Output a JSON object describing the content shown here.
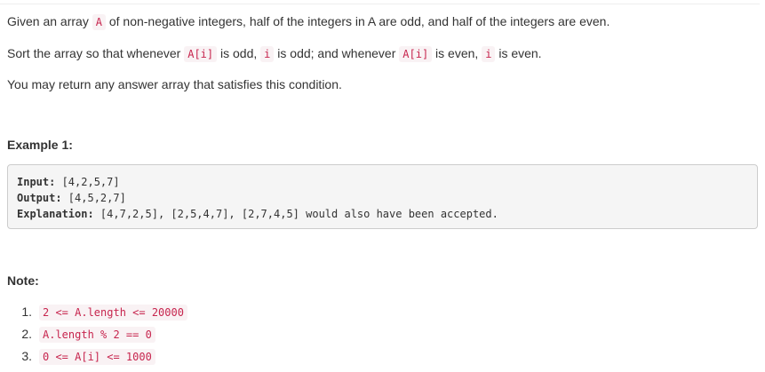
{
  "intro": {
    "p1": {
      "before": "Given an array ",
      "code": "A",
      "after": " of non-negative integers, half of the integers in A are odd, and half of the integers are even."
    },
    "p2": {
      "t1": "Sort the array so that whenever ",
      "c1": "A[i]",
      "t2": " is odd, ",
      "c2": "i",
      "t3": " is odd; and whenever ",
      "c3": "A[i]",
      "t4": " is even, ",
      "c4": "i",
      "t5": " is even."
    },
    "p3": "You may return any answer array that satisfies this condition."
  },
  "example": {
    "heading": "Example 1:",
    "lines": [
      {
        "key": "Input:",
        "value": " [4,2,5,7]"
      },
      {
        "key": "Output:",
        "value": " [4,5,2,7]"
      },
      {
        "key": "Explanation:",
        "value": " [4,7,2,5], [2,5,4,7], [2,7,4,5] would also have been accepted."
      }
    ]
  },
  "note": {
    "heading": "Note:",
    "items": [
      {
        "num": "1.",
        "code": "2 <= A.length <= 20000"
      },
      {
        "num": "2.",
        "code": "A.length % 2 == 0"
      },
      {
        "num": "3.",
        "code": "0 <= A[i] <= 1000"
      }
    ]
  }
}
